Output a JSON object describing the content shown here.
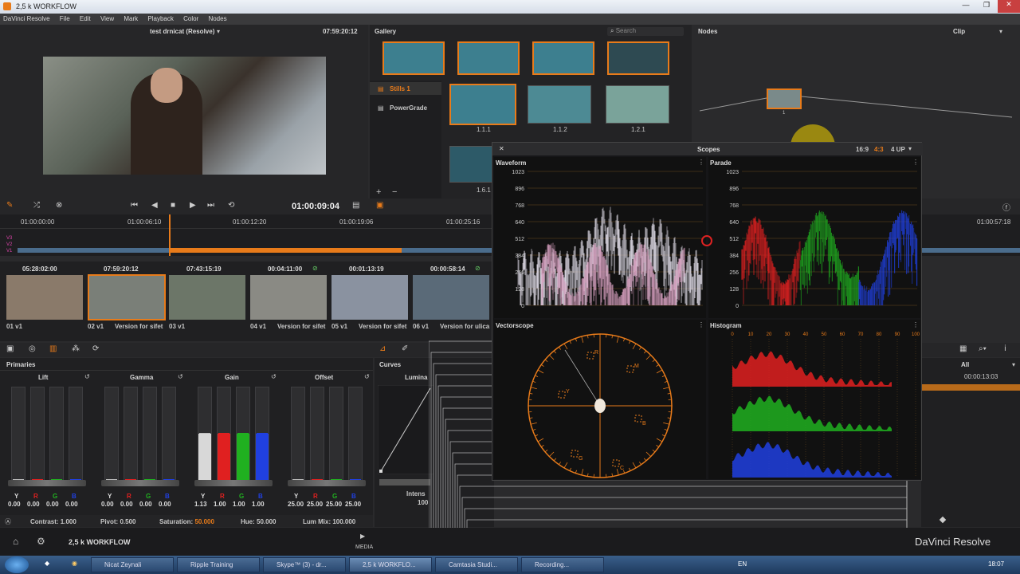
{
  "window": {
    "title": "2,5 k  WORKFLOW"
  },
  "menu": [
    "DaVinci Resolve",
    "File",
    "Edit",
    "View",
    "Mark",
    "Playback",
    "Color",
    "Nodes"
  ],
  "viewer": {
    "clip_name": "test drnicat (Resolve)",
    "timecode": "07:59:20:12"
  },
  "gallery": {
    "title": "Gallery",
    "search_placeholder": "Search",
    "albums": [
      "Stills 1",
      "PowerGrade"
    ],
    "stills": [
      {
        "label": "1.1.1"
      },
      {
        "label": "1.1.2"
      },
      {
        "label": "1.2.1"
      },
      {
        "label": "1.6.1"
      }
    ]
  },
  "nodes": {
    "title": "Nodes",
    "mode": "Clip",
    "node_label": "1"
  },
  "transport": {
    "timecode": "01:00:09:04"
  },
  "timeline": {
    "ticks": [
      "01:00:00:00",
      "01:00:06:10",
      "01:00:12:20",
      "01:00:19:06",
      "01:00:25:16"
    ],
    "end_tc": "01:00:57:18",
    "tracks": [
      "V3",
      "V2",
      "V1"
    ]
  },
  "clips": [
    {
      "tc": "05:28:02:00",
      "num": "01",
      "track": "v1",
      "name": ""
    },
    {
      "tc": "07:59:20:12",
      "num": "02",
      "track": "v1",
      "name": "Version for sifet"
    },
    {
      "tc": "07:43:15:19",
      "num": "03",
      "track": "v1",
      "name": ""
    },
    {
      "tc": "00:04:11:00",
      "num": "04",
      "track": "v1",
      "name": "Version for sifet"
    },
    {
      "tc": "00:01:13:19",
      "num": "05",
      "track": "v1",
      "name": "Version for sifet"
    },
    {
      "tc": "00:00:58:14",
      "num": "06",
      "track": "v1",
      "name": "Version for ulica"
    }
  ],
  "scopes": {
    "title": "Scopes",
    "aspect_options": [
      "16:9",
      "4:3"
    ],
    "layout": "4 UP",
    "panels": [
      "Waveform",
      "Parade",
      "Vectorscope",
      "Histogram"
    ],
    "wave_scale": [
      "1023",
      "896",
      "768",
      "640",
      "512",
      "384",
      "256",
      "128",
      "0"
    ],
    "hist_scale": [
      "0",
      "10",
      "20",
      "30",
      "40",
      "50",
      "60",
      "70",
      "80",
      "90",
      "100"
    ],
    "vector_labels": [
      "R",
      "M",
      "B",
      "C",
      "G",
      "Y"
    ]
  },
  "primaries": {
    "title": "Primaries",
    "wheels": [
      {
        "name": "Lift",
        "vals": [
          "0.00",
          "0.00",
          "0.00",
          "0.00"
        ],
        "levels": [
          0,
          0,
          0,
          0
        ]
      },
      {
        "name": "Gamma",
        "vals": [
          "0.00",
          "0.00",
          "0.00",
          "0.00"
        ],
        "levels": [
          0,
          0,
          0,
          0
        ]
      },
      {
        "name": "Gain",
        "vals": [
          "1.13",
          "1.00",
          "1.00",
          "1.00"
        ],
        "levels": [
          0.5,
          0.5,
          0.5,
          0.5
        ]
      },
      {
        "name": "Offset",
        "vals": [
          "25.00",
          "25.00",
          "25.00",
          "25.00"
        ],
        "levels": [
          0,
          0,
          0,
          0
        ]
      }
    ],
    "channel_letters": [
      "Y",
      "R",
      "G",
      "B"
    ],
    "contrast": "Contrast: 1.000",
    "pivot": "Pivot: 0.500",
    "saturation_label": "Saturation:",
    "saturation_value": "50.000",
    "hue": "Hue: 50.000",
    "lummix": "Lum Mix: 100.000"
  },
  "curves": {
    "title": "Curves",
    "channel": "Lumina",
    "intensity": "Intens",
    "intensity_val": "100"
  },
  "keyframes": {
    "filter": "All",
    "tc": "00:00:13:03"
  },
  "footer": {
    "project": "2,5 k  WORKFLOW",
    "media_label": "MEDIA",
    "brand": "DaVinci Resolve"
  },
  "taskbar": {
    "items": [
      "Nicat Zeynali",
      "Ripple Training",
      "Skype™ (3) - dr...",
      "2,5 k WORKFLO...",
      "Camtasia Studi...",
      "Recording..."
    ],
    "lang": "EN",
    "clock": "18:07"
  },
  "colors": {
    "accent": "#e87b1a",
    "red": "#e02020",
    "green": "#20b020",
    "blue": "#2040e0"
  }
}
